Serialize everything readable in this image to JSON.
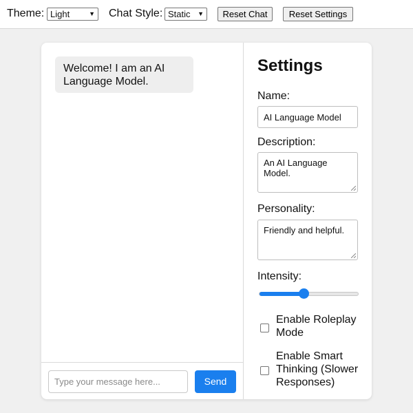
{
  "toolbar": {
    "theme_label": "Theme:",
    "theme_value": "Light",
    "chat_style_label": "Chat Style:",
    "chat_style_value": "Static",
    "reset_chat_label": "Reset Chat",
    "reset_settings_label": "Reset Settings"
  },
  "chat": {
    "messages": [
      {
        "text": "Welcome! I am an AI Language Model."
      }
    ],
    "input_placeholder": "Type your message here...",
    "send_label": "Send"
  },
  "settings": {
    "title": "Settings",
    "name_label": "Name:",
    "name_value": "AI Language Model",
    "description_label": "Description:",
    "description_value": "An AI Language Model.",
    "personality_label": "Personality:",
    "personality_value": "Friendly and helpful.",
    "intensity_label": "Intensity:",
    "intensity_value": 0.45,
    "roleplay_label": "Enable Roleplay Mode",
    "roleplay_checked": false,
    "smart_thinking_label": "Enable Smart Thinking (Slower Responses)",
    "smart_thinking_checked": false
  },
  "colors": {
    "accent": "#1a7fee",
    "page_background": "#f0f0f0",
    "bubble_background": "#eeeeee"
  }
}
